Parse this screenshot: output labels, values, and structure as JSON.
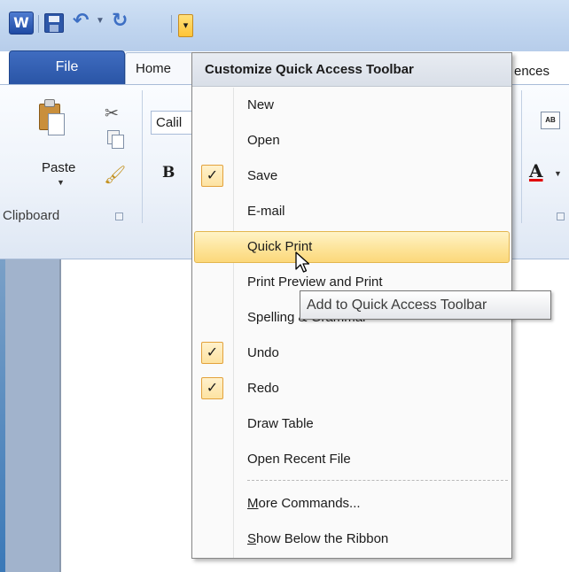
{
  "quick_access": {
    "app_icon": "W",
    "save_icon": "save-icon",
    "undo_icon": "undo-icon",
    "redo_icon": "redo-icon",
    "customize_arrow": "▾"
  },
  "ribbon": {
    "tabs": {
      "file": "File",
      "home": "Home",
      "references_partial": "ences"
    },
    "clipboard": {
      "paste_label": "Paste",
      "group_label": "Clipboard"
    },
    "font": {
      "name_partial": "Calil",
      "bold": "B",
      "font_color": "A",
      "style_icon_text": "AB"
    }
  },
  "customize_menu": {
    "header": "Customize Quick Access Toolbar",
    "items": [
      {
        "label": "New",
        "checked": false
      },
      {
        "label": "Open",
        "checked": false
      },
      {
        "label": "Save",
        "checked": true
      },
      {
        "label": "E-mail",
        "checked": false
      },
      {
        "label": "Quick Print",
        "checked": false,
        "hovered": true
      },
      {
        "label": "Print Preview and Print",
        "checked": false
      },
      {
        "label": "Spelling & Grammar",
        "checked": false
      },
      {
        "label": "Undo",
        "checked": true
      },
      {
        "label": "Redo",
        "checked": true
      },
      {
        "label": "Draw Table",
        "checked": false
      },
      {
        "label": "Open Recent File",
        "checked": false
      }
    ],
    "more_commands": {
      "mnemonic": "M",
      "rest": "ore Commands..."
    },
    "show_below": {
      "mnemonic": "S",
      "rest": "how Below the Ribbon"
    },
    "check_glyph": "✓"
  },
  "tooltip": {
    "text": "Add to Quick Access Toolbar"
  },
  "colors": {
    "title_bar": "#c0d5ef",
    "file_tab": "#2a55a6",
    "menu_hover": "#fde49a",
    "check_border": "#e3a23c"
  }
}
